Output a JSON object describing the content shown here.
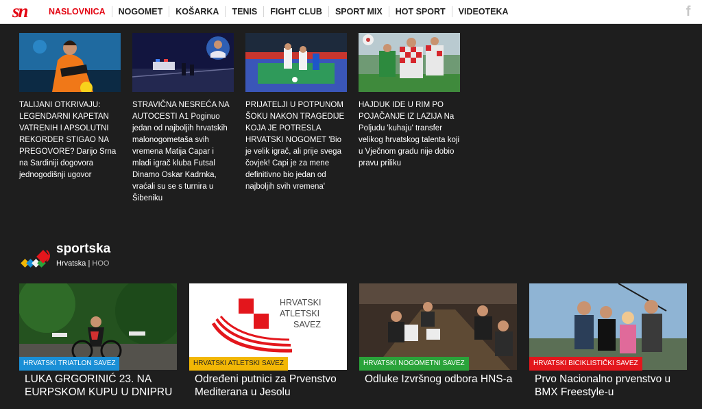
{
  "header": {
    "logo": "sn",
    "nav": [
      {
        "label": "NASLOVNICA",
        "active": true
      },
      {
        "label": "NOGOMET"
      },
      {
        "label": "KOŠARKA"
      },
      {
        "label": "TENIS"
      },
      {
        "label": "FIGHT CLUB"
      },
      {
        "label": "SPORT MIX"
      },
      {
        "label": "HOT SPORT"
      },
      {
        "label": "VIDEOTEKA"
      }
    ],
    "social_icon": "facebook-icon",
    "brand_color": "#e30613"
  },
  "top_cards": [
    {
      "headline": "TALIJANI OTKRIVAJU: LEGENDARNI KAPETAN VATRENIH I APSOLUTNI REKORDER STIGAO NA PREGOVORE?",
      "text": " Darijo Srna na Sardiniji dogovora jednogodišnji ugovor"
    },
    {
      "headline": "STRAVIČNA NESREĆA NA AUTOCESTI A1",
      "text": " Poginuo jedan od najboljih hrvatskih malonogometaša svih vremena Matija Capar i mladi igrač kluba Futsal Dinamo Oskar Kadrnka, vraćali su se s turnira u Šibeniku"
    },
    {
      "headline": "PRIJATELJI U POTPUNOM ŠOKU NAKON TRAGEDIJE KOJA JE POTRESLA HRVATSKI NOGOMET",
      "text": " 'Bio je velik igrač, ali prije svega čovjek! Capi je za mene definitivno bio jedan od najboljih svih vremena'"
    },
    {
      "headline": "HAJDUK IDE U RIM PO POJAČANJE IZ LAZIJA",
      "text": " Na Poljudu 'kuhaju' transfer velikog hrvatskog talenta koji u Vječnom gradu nije dobio pravu priliku"
    }
  ],
  "section": {
    "name": "sportska",
    "sub": "Hrvatska",
    "org": "HOO"
  },
  "bottom_cards": [
    {
      "category": "HRVATSKI TRIATLON SAVEZ",
      "color": "#1a8fd6",
      "title": "LUKA GRGORINIĆ 23. NA EURPSKOM KUPU U DNIPRU"
    },
    {
      "category": "HRVATSKI ATLETSKI SAVEZ",
      "color": "#f2b705",
      "title": "Određeni putnici za Prvenstvo Mediterana u Jesolu",
      "logo_text": [
        "HRVATSKI",
        "ATLETSKI",
        "SAVEZ"
      ]
    },
    {
      "category": "HRVATSKI NOGOMETNI SAVEZ",
      "color": "#2aa33a",
      "title": "Odluke Izvršnog odbora HNS-a"
    },
    {
      "category": "HRVATSKI BICIKLISTIČKI SAVEZ",
      "color": "#e3161c",
      "title": "Prvo Nacionalno prvenstvo u BMX Freestyle-u"
    }
  ]
}
